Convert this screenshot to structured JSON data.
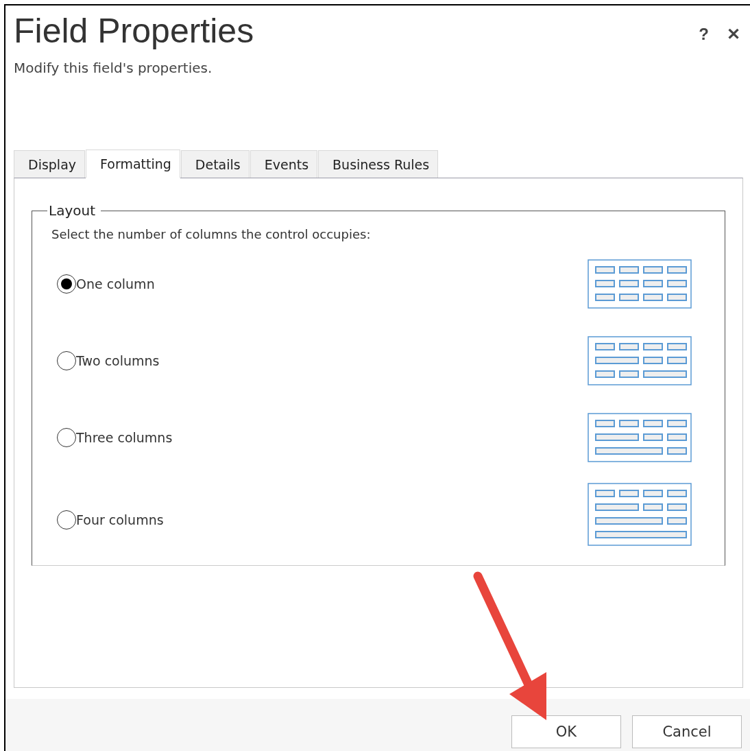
{
  "dialog": {
    "title": "Field Properties",
    "subtitle": "Modify this field's properties.",
    "help": "?",
    "close": "✕"
  },
  "tabs": [
    {
      "label": "Display",
      "selected": false
    },
    {
      "label": "Formatting",
      "selected": true
    },
    {
      "label": "Details",
      "selected": false
    },
    {
      "label": "Events",
      "selected": false
    },
    {
      "label": "Business Rules",
      "selected": false
    }
  ],
  "layout": {
    "legend": "Layout",
    "prompt": "Select the number of columns the control occupies:",
    "options": [
      {
        "label": "One column",
        "selected": true
      },
      {
        "label": "Two columns",
        "selected": false
      },
      {
        "label": "Three columns",
        "selected": false
      },
      {
        "label": "Four columns",
        "selected": false
      }
    ]
  },
  "buttons": [
    {
      "label": "OK"
    },
    {
      "label": "Cancel"
    }
  ]
}
